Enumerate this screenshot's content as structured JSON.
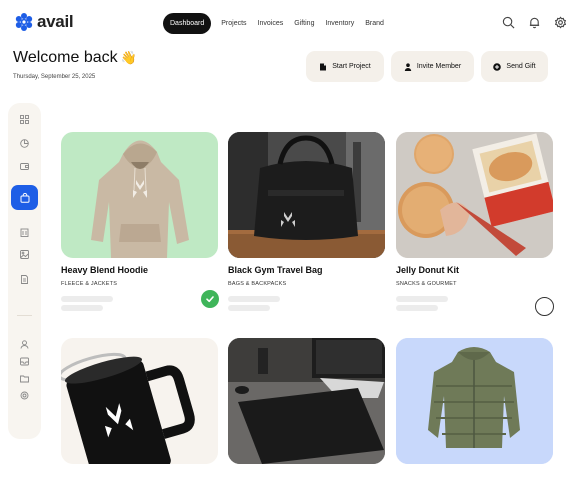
{
  "brand": {
    "name": "avail",
    "logo_color": "#1e5ee6"
  },
  "nav": {
    "items": [
      "Dashboard",
      "Projects",
      "Invoices",
      "Gifting",
      "Inventory",
      "Brand"
    ],
    "active": "Dashboard"
  },
  "header_icons": [
    "search-icon",
    "bell-icon",
    "settings-icon"
  ],
  "welcome": {
    "title": "Welcome back",
    "emoji": "👋",
    "date": "Thursday, September 25, 2025"
  },
  "actions": [
    {
      "label": "Start Project",
      "icon": "document-icon"
    },
    {
      "label": "Invite Member",
      "icon": "user-icon"
    },
    {
      "label": "Send Gift",
      "icon": "gift-icon"
    }
  ],
  "sidebar": {
    "items": [
      "grid-icon",
      "pie-chart-icon",
      "wallet-icon",
      "bag-icon",
      "building-icon",
      "image-icon",
      "document-icon",
      "user-icon",
      "inbox-icon",
      "folder-icon",
      "settings-icon"
    ],
    "active": "bag-icon",
    "active_color": "#1e5ee6"
  },
  "products": [
    {
      "title": "Heavy Blend Hoodie",
      "category": "FLEECE & JACKETS",
      "selected": true,
      "bg": "#bfe9c4"
    },
    {
      "title": "Black Gym Travel Bag",
      "category": "BAGS & BACKPACKS",
      "selected": false,
      "bg": "#3a3a3a"
    },
    {
      "title": "Jelly Donut Kit",
      "category": "SNACKS & GOURMET",
      "selected": false,
      "bg": "#d8d4cf"
    }
  ],
  "product_images_row2": [
    {
      "subject": "insulated mug",
      "bg": "#f7f3ee"
    },
    {
      "subject": "desk mat",
      "bg": "#5a5a58"
    },
    {
      "subject": "puffer jacket",
      "bg": "#c8d8fb"
    }
  ],
  "colors": {
    "check": "#3fb55a",
    "card_bg": "#f4f0ea"
  }
}
